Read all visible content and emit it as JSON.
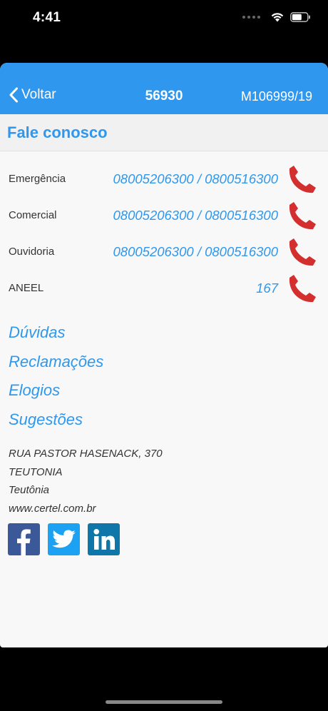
{
  "status_bar": {
    "time": "4:41"
  },
  "nav": {
    "back_label": "Voltar",
    "title": "56930",
    "right_text": "M106999/19"
  },
  "section": {
    "title": "Fale conosco"
  },
  "phones": [
    {
      "label": "Emergência",
      "number": "08005206300 / 0800516300"
    },
    {
      "label": "Comercial",
      "number": "08005206300 / 0800516300"
    },
    {
      "label": "Ouvidoria",
      "number": "08005206300 / 0800516300"
    },
    {
      "label": "ANEEL",
      "number": "167"
    }
  ],
  "links": [
    "Dúvidas",
    "Reclamações",
    "Elogios",
    "Sugestões"
  ],
  "address": {
    "street": "RUA PASTOR HASENACK, 370",
    "district": "TEUTONIA",
    "city": "Teutônia",
    "website": "www.certel.com.br"
  },
  "social": [
    {
      "icon": "facebook-icon",
      "color": "#3b5998"
    },
    {
      "icon": "twitter-icon",
      "color": "#1da1f2"
    },
    {
      "icon": "linkedin-icon",
      "color": "#0e76a8"
    }
  ],
  "colors": {
    "accent": "#2f98ee",
    "phone_icon": "#d32f2f"
  }
}
